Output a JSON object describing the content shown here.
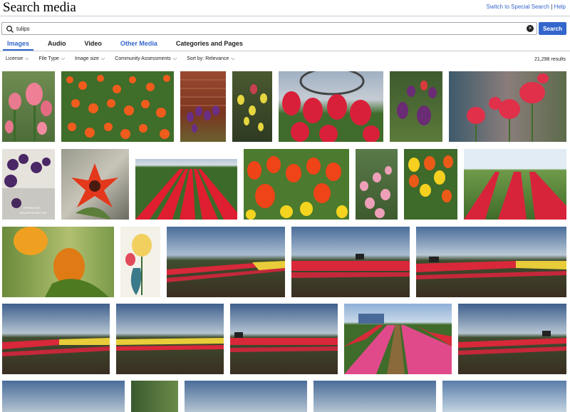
{
  "page": {
    "title": "Search media"
  },
  "top_links": {
    "special": "Switch to Special Search",
    "separator": "|",
    "help": "Help"
  },
  "search": {
    "value": "tulips",
    "button_label": "Search"
  },
  "tabs": [
    {
      "label": "Images",
      "active": true
    },
    {
      "label": "Audio"
    },
    {
      "label": "Video"
    },
    {
      "label": "Other Media"
    },
    {
      "label": "Categories and Pages"
    }
  ],
  "filters": [
    {
      "label": "License"
    },
    {
      "label": "File Type"
    },
    {
      "label": "Image size"
    },
    {
      "label": "Community Assessments"
    },
    {
      "label": "Sort by: Relevance"
    }
  ],
  "results": {
    "count_label": "21,298 results"
  },
  "image_text": {
    "spring_mix_1": "SPRING MIX",
    "spring_mix_2": "AND APPRECIATE THE"
  },
  "colors": {
    "accent": "#3366cc",
    "border": "#c8ccd1"
  }
}
